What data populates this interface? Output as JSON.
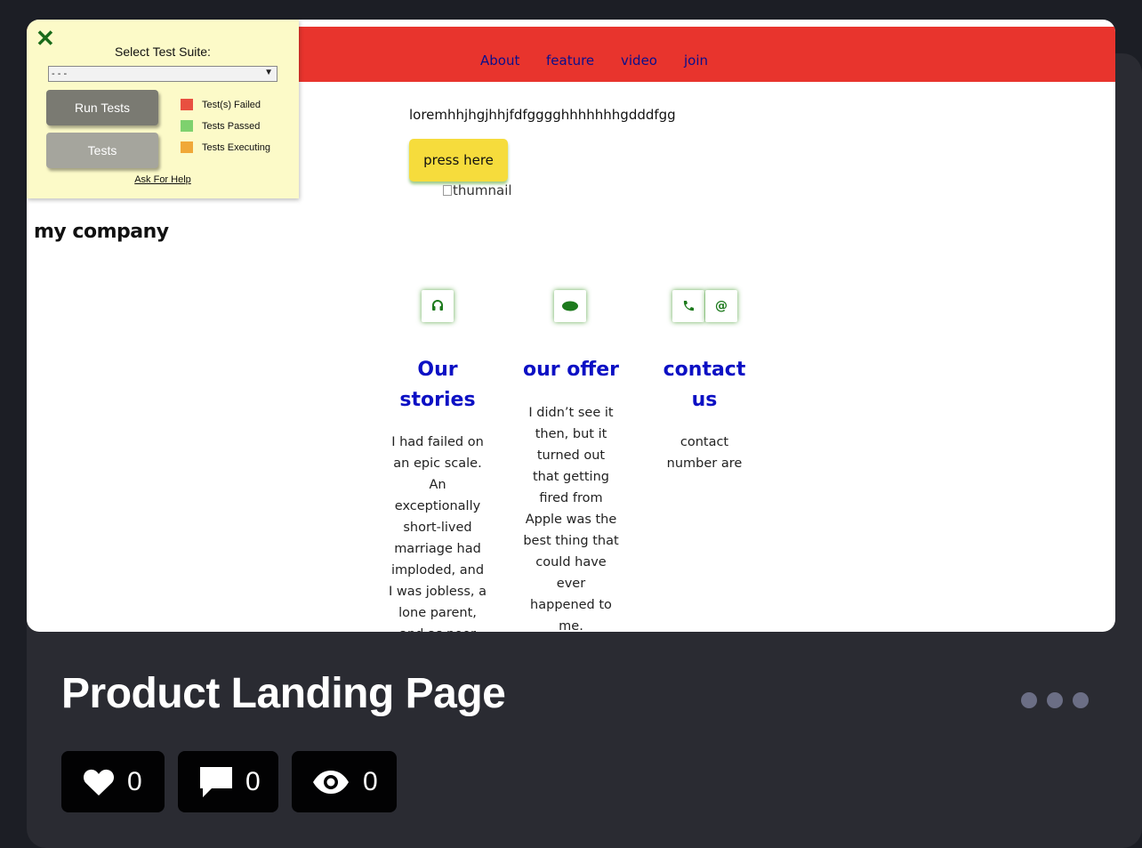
{
  "preview": {
    "nav": [
      "About",
      "feature",
      "video",
      "join"
    ],
    "brand": "my company",
    "lorem": "loremhhjhgjhhjfdfgggghhhhhhhgdddfgg",
    "press_button": "press here",
    "thumbnail_alt": "thumnail",
    "features": [
      {
        "icon": "headset-icon",
        "title_lines": [
          "Our",
          "stories"
        ],
        "text_lines": [
          "I had failed on",
          "an epic scale.",
          "An",
          "exceptionally",
          "short-lived",
          "marriage had",
          "imploded, and",
          "I was jobless, a",
          "lone parent,",
          "and as poor"
        ]
      },
      {
        "icon": "salesforce-cloud-icon",
        "title_lines": [
          "our offer"
        ],
        "text_lines": [
          "I didn’t see it",
          "then, but it",
          "turned out",
          "that getting",
          "fired from",
          "Apple was the",
          "best thing that",
          "could have",
          "ever",
          "happened to",
          "me."
        ]
      },
      {
        "icons": [
          "phone-icon",
          "at-sign-icon"
        ],
        "title_lines": [
          "contact",
          "us"
        ],
        "text_lines": [
          "contact",
          "number are"
        ]
      }
    ]
  },
  "test_panel": {
    "title": "Select Test Suite:",
    "select_value": "- - -",
    "run_button": "Run Tests",
    "tests_button": "Tests",
    "legend": [
      {
        "label": "Test(s) Failed",
        "color": "#e85040"
      },
      {
        "label": "Tests Passed",
        "color": "#7ed16e"
      },
      {
        "label": "Tests Executing",
        "color": "#f0a838"
      }
    ],
    "help_link": "Ask For Help"
  },
  "project": {
    "title": "Product Landing Page",
    "likes": "0",
    "comments": "0",
    "views": "0"
  },
  "colors": {
    "nav_bg": "#e8342d",
    "accent_blue": "#0c10c4",
    "button_yellow": "#f6dc3c",
    "page_bg": "#1c1e25",
    "card_bg": "#2a2b32"
  }
}
